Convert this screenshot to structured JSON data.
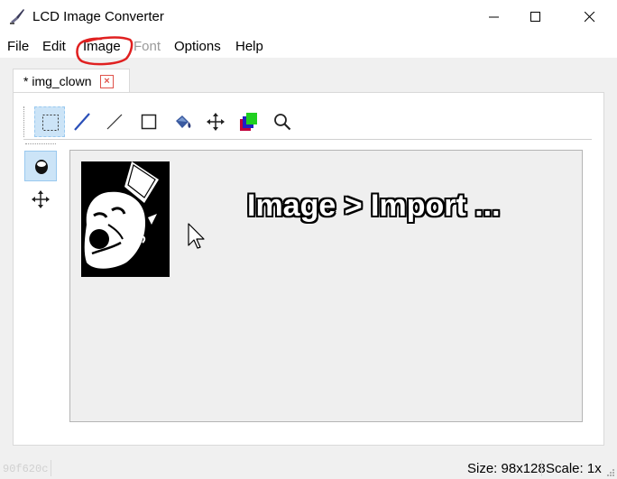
{
  "window": {
    "title": "LCD Image Converter"
  },
  "menu": {
    "items": [
      {
        "label": "File"
      },
      {
        "label": "Edit"
      },
      {
        "label": "Image"
      },
      {
        "label": "Font"
      },
      {
        "label": "Options"
      },
      {
        "label": "Help"
      }
    ]
  },
  "tab": {
    "label": "* img_clown",
    "close_glyph": "×"
  },
  "toolbar": {
    "tools": [
      "selection-tool",
      "pen-tool",
      "line-tool",
      "rectangle-tool",
      "fill-tool",
      "move-tool",
      "color-tool",
      "zoom-tool"
    ]
  },
  "sidebar": {
    "tools": [
      "brush-size-tool",
      "move-tool"
    ]
  },
  "canvas": {
    "overlay_text": "Image > Import ..."
  },
  "status": {
    "code": "90f620c",
    "size": "Size: 98x128",
    "scale": "Scale: 1x"
  },
  "colors": {
    "accent": "#cce4f7",
    "annotation": "#e02020"
  }
}
